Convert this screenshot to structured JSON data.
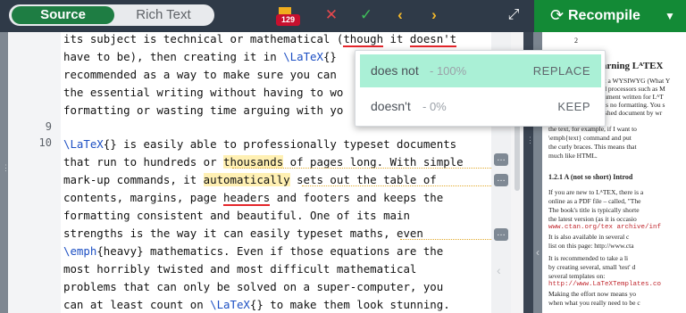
{
  "toolbar": {
    "source_label": "Source",
    "rich_text_label": "Rich Text",
    "issue_count": "129",
    "recompile_label": "Recompile",
    "icons": [
      "bookmark-icon",
      "close-icon",
      "check-icon",
      "chevron-left-icon",
      "chevron-right-icon",
      "expand-icon",
      "refresh-icon",
      "caret-down-icon"
    ],
    "colors": {
      "toolbar_bg": "#2f3a48",
      "source_active": "#1e7d43",
      "recompile": "#138a36",
      "badge": "#c8102e",
      "close": "#e5484d",
      "check": "#3fbf5a",
      "nav": "#f2b72b"
    }
  },
  "editor": {
    "line_numbers": [
      "9",
      "10"
    ],
    "lines": [
      {
        "a": "its subject is technical or mathematical (",
        "b": "though",
        "c": " it ",
        "d": "doesn't",
        "e": ""
      },
      {
        "a": "have to be), then creating it in ",
        "cmd": "\\LaTeX",
        "b": "{}"
      },
      {
        "a": "recommended as a way to make sure you can"
      },
      {
        "a": "the essential writing without having to wo"
      },
      {
        "a": "formatting or wasting time arguing with yo"
      },
      {
        "a": ""
      },
      {
        "cmd": "\\LaTeX",
        "a": "{} is easily able to professionally typeset documents"
      },
      {
        "a": "that run to hundreds or ",
        "b": "thousands",
        "c": " of pages long. With simple"
      },
      {
        "a": "mark-up commands, it ",
        "b": "automatically",
        "c": " sets out the table of"
      },
      {
        "a": "contents, margins, page ",
        "b": "headers",
        "c": " and footers and keeps the"
      },
      {
        "a": "formatting consistent and beautiful. One of its main"
      },
      {
        "a": "strengths is the way it can easily typeset maths, even"
      },
      {
        "cmd": "\\emph",
        "a": "{heavy} mathematics. Even if those equations are the"
      },
      {
        "a": "most horribly twisted and most difficult mathematical"
      },
      {
        "a": "problems that can only be solved on a super-computer, you"
      },
      {
        "a": "can at least count on ",
        "cmd": "\\LaTeX",
        "b": "{} to make them look stunning."
      }
    ]
  },
  "suggestions": [
    {
      "word": "does not",
      "confidence": "- 100%",
      "action": "REPLACE"
    },
    {
      "word": "doesn't",
      "confidence": "- 0%",
      "action": "KEEP"
    }
  ],
  "pdf": {
    "page_number": "2",
    "heading": "earning LᴬTEX",
    "lines": [
      "not a WYSIWYG (What Y",
      "ord processors such as M",
      "ocument written for LᴬT",
      "ains no formatting. You s",
      "inished document by wr",
      "the text, for example, if I want to",
      "\\emph{text} command and put",
      "the curly braces. This means that",
      "much like HTML.",
      "1.2.1   A (not so short) Introd",
      "If you are new to LᴬTEX, there is a",
      "online as a PDF file – called, \"The",
      "The book's title is typically shorte",
      "the latest version (as it is occasio",
      "www.ctan.org/tex archive/inf",
      "    It is also available in several c",
      "list on this page: http://www.cta",
      "    It is recommended to take a li",
      "by creating several, small 'test' d",
      "several templates on:",
      "http://www.LaTeXTemplates.co",
      "Making the effort now means yo",
      "when what you really need to be c"
    ]
  }
}
